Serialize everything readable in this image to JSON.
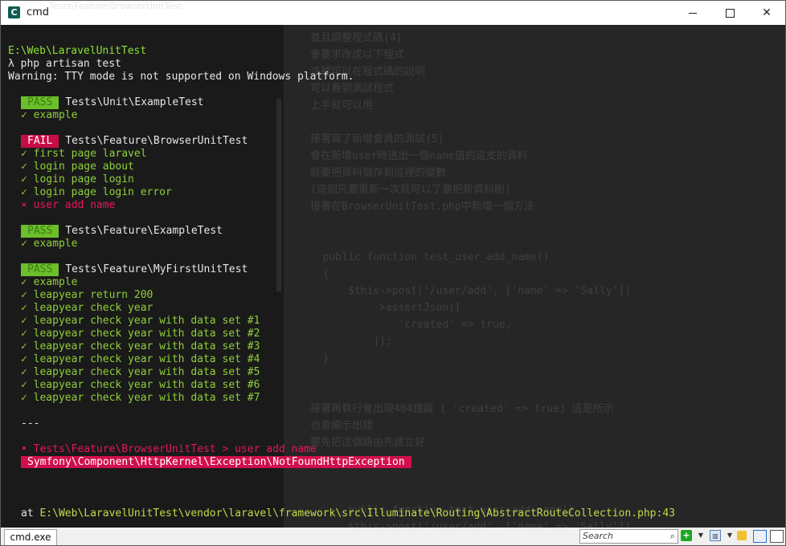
{
  "window": {
    "title": "cmd",
    "ghost_title": "Tests\\Feature\\BrowserUnitTest",
    "app_icon_glyph": "C"
  },
  "console": {
    "prompt_path": "E:\\Web\\LaravelUnitTest",
    "command": "λ php artisan test",
    "warning": "Warning: TTY mode is not supported on Windows platform.",
    "suites": [
      {
        "status": "PASS",
        "name": "Tests\\Unit\\ExampleTest",
        "tests": [
          "✓ example"
        ]
      },
      {
        "status": "FAIL",
        "name": "Tests\\Feature\\BrowserUnitTest",
        "tests": [
          "✓ first page laravel",
          "✓ login page about",
          "✓ login page login",
          "✓ login page login error",
          "⨯ user add name"
        ]
      },
      {
        "status": "PASS",
        "name": "Tests\\Feature\\ExampleTest",
        "tests": [
          "✓ example"
        ]
      },
      {
        "status": "PASS",
        "name": "Tests\\Feature\\MyFirstUnitTest",
        "tests": [
          "✓ example",
          "✓ leapyear return 200",
          "✓ leapyear check year",
          "✓ leapyear check year with data set #1",
          "✓ leapyear check year with data set #2",
          "✓ leapyear check year with data set #3",
          "✓ leapyear check year with data set #4",
          "✓ leapyear check year with data set #5",
          "✓ leapyear check year with data set #6",
          "✓ leapyear check year with data set #7"
        ]
      }
    ],
    "separator": "---",
    "failure_location": "• Tests\\Feature\\BrowserUnitTest > user add name",
    "exception": "Symfony\\Component\\HttpKernel\\Exception\\NotFoundHttpException",
    "at_label": "at",
    "at_path": "E:\\Web\\LaravelUnitTest\\vendor\\laravel\\framework\\src\\Illuminate\\Routing\\AbstractRouteCollection.php:43",
    "background_ghost": [
      "並且調整程式碼(4)",
      "會要求改成以下程式",
      "這裡可以在程式碼的說明",
      "可以看到測試程式",
      "上手就可以用",
      "",
      "接著寫了新增會員的測試(5)",
      "會在新增user時送出一個name值的這支的資料",
      "就要把資料儲存到這裡的變數",
      "(這個只要重新一次就可以了要把新資料刪)",
      "接著在BrowserUnitTest.php中新增一個方法",
      "",
      "",
      "  public function test_user_add_name()",
      "  {",
      "      $this->post('/user/add', ['name' => 'Sally'])",
      "          ->assertJson([",
      "              'created' => true,",
      "          ]);",
      "  }",
      "",
      "",
      "接著再執行會出現404錯誤 [ 'created' => true] 這是所示",
      "也會顯示出錯",
      "要先把這個路由先建立好",
      "",
      "",
      "",
      "      public function test_user_add_name()",
      "      $this->post('/user/add', ['name' => 'Sally'])"
    ]
  },
  "statusbar": {
    "tab_label": "cmd.exe",
    "search_placeholder": "Search"
  },
  "colors": {
    "console_bg": "#262626",
    "pass_tag": "#6bbf2a",
    "fail_tag": "#c70d47",
    "path_green": "#8ae234",
    "error_pink": "#e5165c"
  }
}
